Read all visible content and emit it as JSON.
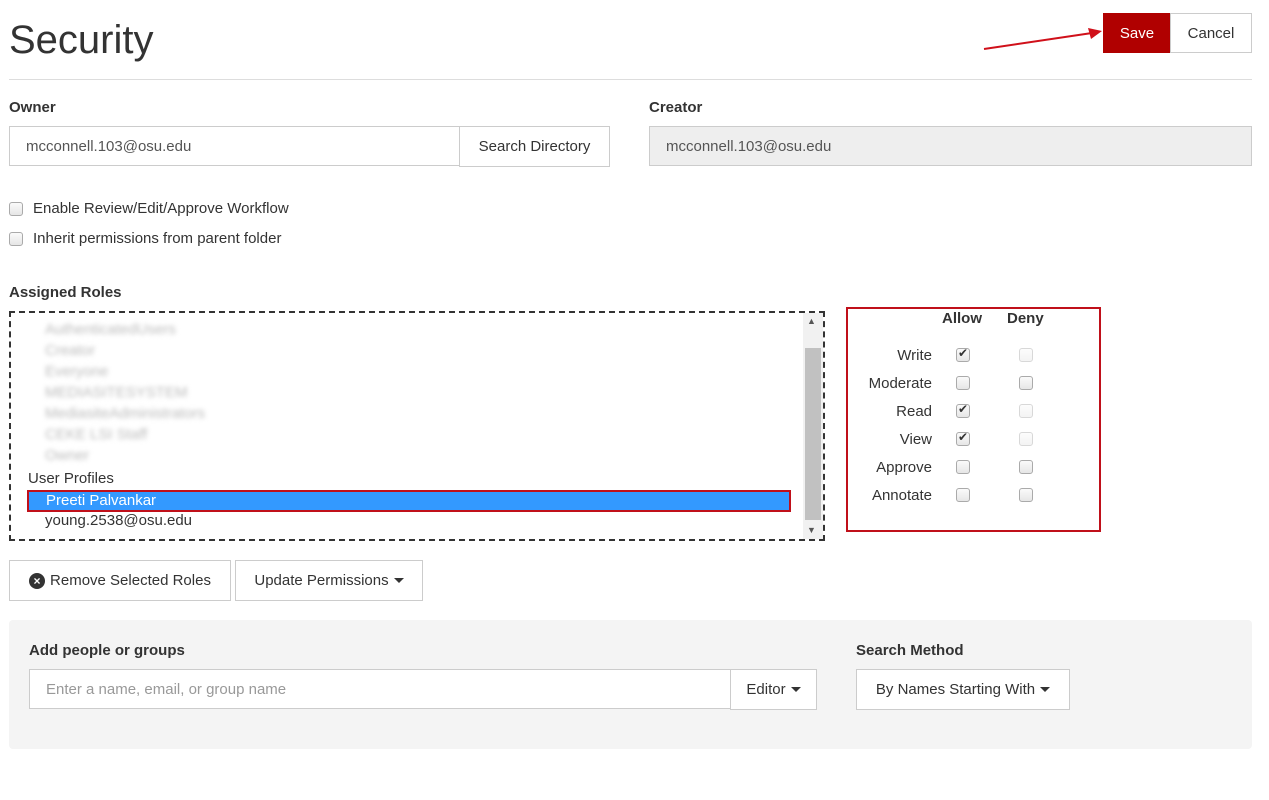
{
  "header": {
    "title": "Security",
    "save_label": "Save",
    "cancel_label": "Cancel"
  },
  "owner": {
    "label": "Owner",
    "value": "mcconnell.103@osu.edu",
    "search_label": "Search Directory"
  },
  "creator": {
    "label": "Creator",
    "value": "mcconnell.103@osu.edu"
  },
  "options": [
    {
      "label": "Enable Review/Edit/Approve Workflow",
      "checked": false
    },
    {
      "label": "Inherit permissions from parent folder",
      "checked": false
    }
  ],
  "assigned_roles": {
    "label": "Assigned Roles",
    "blurred_items": [
      "AuthenticatedUsers",
      "Creator",
      "Everyone",
      "MEDIASITESYSTEM",
      "MediasiteAdministrators",
      "CEKE LSI Staff",
      "Owner"
    ],
    "group_header": "User Profiles",
    "selected_item": "Preeti Palvankar",
    "other_item": "young.2538@osu.edu"
  },
  "permissions": {
    "allow_label": "Allow",
    "deny_label": "Deny",
    "rows": [
      {
        "name": "Write",
        "allow": true,
        "deny": false,
        "deny_disabled": true
      },
      {
        "name": "Moderate",
        "allow": false,
        "deny": false,
        "deny_disabled": false
      },
      {
        "name": "Read",
        "allow": true,
        "deny": false,
        "deny_disabled": true
      },
      {
        "name": "View",
        "allow": true,
        "deny": false,
        "deny_disabled": true
      },
      {
        "name": "Approve",
        "allow": false,
        "deny": false,
        "deny_disabled": false
      },
      {
        "name": "Annotate",
        "allow": false,
        "deny": false,
        "deny_disabled": false
      }
    ]
  },
  "actions": {
    "remove_label": "Remove Selected Roles",
    "update_label": "Update Permissions"
  },
  "add_people": {
    "label": "Add people or groups",
    "placeholder": "Enter a name, email, or group name",
    "role_value": "Editor",
    "search_method_label": "Search Method",
    "search_method_value": "By Names Starting With"
  },
  "colors": {
    "save": "#b00000",
    "selection": "#3399ff",
    "highlight_border": "#c0101a"
  }
}
